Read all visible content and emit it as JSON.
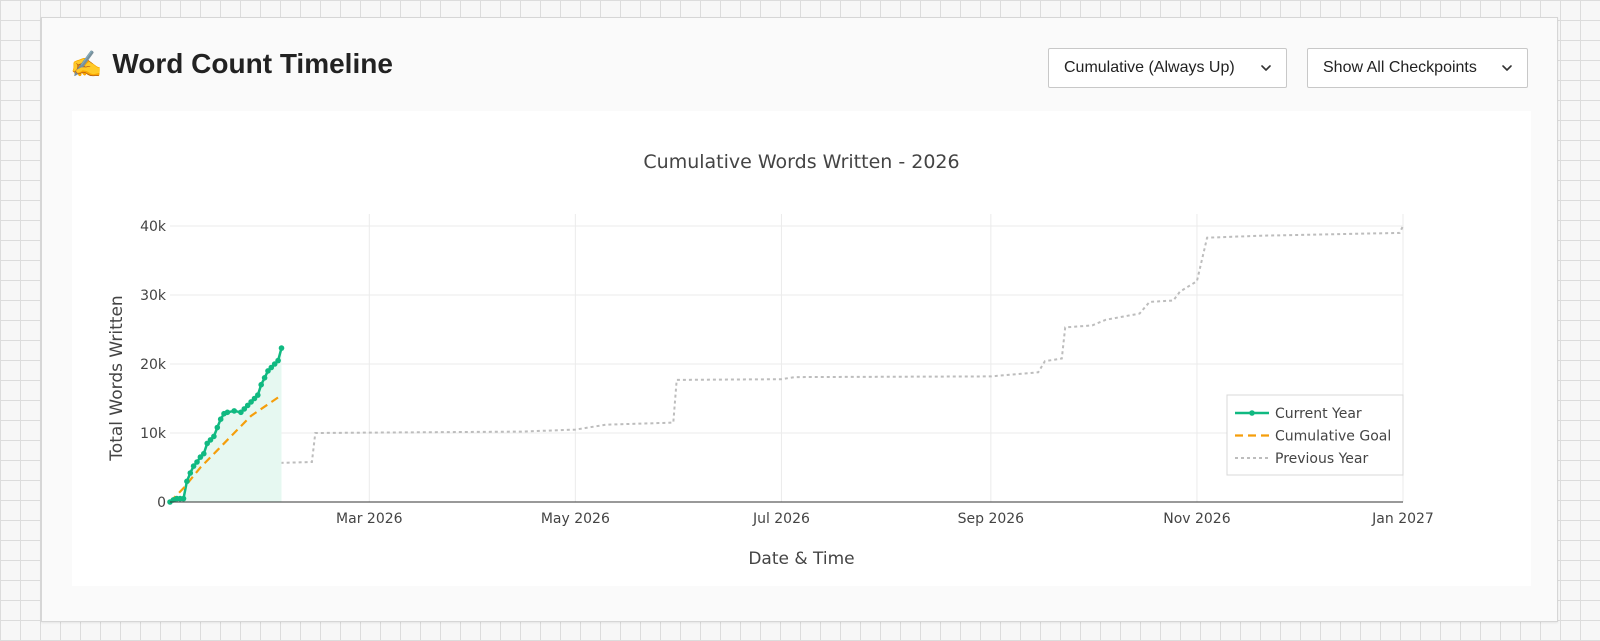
{
  "header": {
    "icon": "writing-hand-icon",
    "icon_glyph": "✍️",
    "title": "Word Count Timeline"
  },
  "controls": {
    "mode_select": {
      "value": "Cumulative (Always Up)",
      "icon": "chevron-down-icon"
    },
    "checkpoint_select": {
      "value": "Show All Checkpoints",
      "icon": "chevron-down-icon"
    }
  },
  "colors": {
    "current_year": "#10b981",
    "current_year_fill": "#e6f8f1",
    "goal": "#f59e0b",
    "previous_year": "#bdbdbd",
    "grid": "#ebebeb",
    "axis": "#444444"
  },
  "chart_data": {
    "type": "line",
    "title": "Cumulative Words Written - 2026",
    "xlabel": "Date & Time",
    "ylabel": "Total Words Written",
    "xlim": [
      "2026-01-01",
      "2027-01-01"
    ],
    "ylim": [
      0,
      40000
    ],
    "grid": true,
    "legend_position": "bottom-right",
    "x_ticks": [
      {
        "date": "2026-03-01",
        "label": "Mar 2026"
      },
      {
        "date": "2026-05-01",
        "label": "May 2026"
      },
      {
        "date": "2026-07-01",
        "label": "Jul 2026"
      },
      {
        "date": "2026-09-01",
        "label": "Sep 2026"
      },
      {
        "date": "2026-11-01",
        "label": "Nov 2026"
      },
      {
        "date": "2027-01-01",
        "label": "Jan 2027"
      }
    ],
    "y_ticks": [
      {
        "value": 0,
        "label": "0"
      },
      {
        "value": 10000,
        "label": "10k"
      },
      {
        "value": 20000,
        "label": "20k"
      },
      {
        "value": 30000,
        "label": "30k"
      },
      {
        "value": 40000,
        "label": "40k"
      }
    ],
    "series": [
      {
        "name": "Current Year",
        "style": "solid-markers-fill",
        "points": [
          [
            "2026-01-01",
            0
          ],
          [
            "2026-01-02",
            300
          ],
          [
            "2026-01-03",
            500
          ],
          [
            "2026-01-04",
            500
          ],
          [
            "2026-01-05",
            500
          ],
          [
            "2026-01-06",
            3000
          ],
          [
            "2026-01-07",
            4200
          ],
          [
            "2026-01-08",
            5200
          ],
          [
            "2026-01-09",
            5800
          ],
          [
            "2026-01-10",
            6500
          ],
          [
            "2026-01-11",
            7000
          ],
          [
            "2026-01-12",
            8500
          ],
          [
            "2026-01-13",
            9000
          ],
          [
            "2026-01-14",
            9500
          ],
          [
            "2026-01-15",
            10800
          ],
          [
            "2026-01-16",
            12000
          ],
          [
            "2026-01-17",
            12800
          ],
          [
            "2026-01-18",
            13000
          ],
          [
            "2026-01-20",
            13200
          ],
          [
            "2026-01-22",
            13000
          ],
          [
            "2026-01-23",
            13500
          ],
          [
            "2026-01-24",
            14000
          ],
          [
            "2026-01-25",
            14500
          ],
          [
            "2026-01-26",
            15000
          ],
          [
            "2026-01-27",
            15500
          ],
          [
            "2026-01-28",
            17000
          ],
          [
            "2026-01-29",
            18000
          ],
          [
            "2026-01-30",
            19000
          ],
          [
            "2026-01-31",
            19500
          ],
          [
            "2026-02-01",
            20000
          ],
          [
            "2026-02-02",
            20500
          ],
          [
            "2026-02-03",
            22300
          ]
        ]
      },
      {
        "name": "Cumulative Goal",
        "style": "dashed",
        "points": [
          [
            "2026-01-01",
            0
          ],
          [
            "2026-01-05",
            2000
          ],
          [
            "2026-01-10",
            5000
          ],
          [
            "2026-01-15",
            7500
          ],
          [
            "2026-01-20",
            10000
          ],
          [
            "2026-01-25",
            12500
          ],
          [
            "2026-02-03",
            15500
          ]
        ]
      },
      {
        "name": "Previous Year",
        "style": "dotted",
        "points": [
          [
            "2026-01-01",
            0
          ],
          [
            "2026-01-06",
            800
          ],
          [
            "2026-01-12",
            1800
          ],
          [
            "2026-01-18",
            2800
          ],
          [
            "2026-01-20",
            4000
          ],
          [
            "2026-01-24",
            4600
          ],
          [
            "2026-01-28",
            5600
          ],
          [
            "2026-02-12",
            5800
          ],
          [
            "2026-02-13",
            10000
          ],
          [
            "2026-04-15",
            10200
          ],
          [
            "2026-05-01",
            10500
          ],
          [
            "2026-05-10",
            11200
          ],
          [
            "2026-05-30",
            11500
          ],
          [
            "2026-05-31",
            17700
          ],
          [
            "2026-07-01",
            17800
          ],
          [
            "2026-07-05",
            18100
          ],
          [
            "2026-09-01",
            18200
          ],
          [
            "2026-09-15",
            18800
          ],
          [
            "2026-09-17",
            20400
          ],
          [
            "2026-09-22",
            20800
          ],
          [
            "2026-09-23",
            25300
          ],
          [
            "2026-10-01",
            25600
          ],
          [
            "2026-10-05",
            26400
          ],
          [
            "2026-10-15",
            27300
          ],
          [
            "2026-10-18",
            29000
          ],
          [
            "2026-10-25",
            29200
          ],
          [
            "2026-10-27",
            30500
          ],
          [
            "2026-11-01",
            32000
          ],
          [
            "2026-11-04",
            38300
          ],
          [
            "2026-11-20",
            38600
          ],
          [
            "2026-12-31",
            39000
          ],
          [
            "2027-01-01",
            40000
          ]
        ]
      }
    ]
  }
}
